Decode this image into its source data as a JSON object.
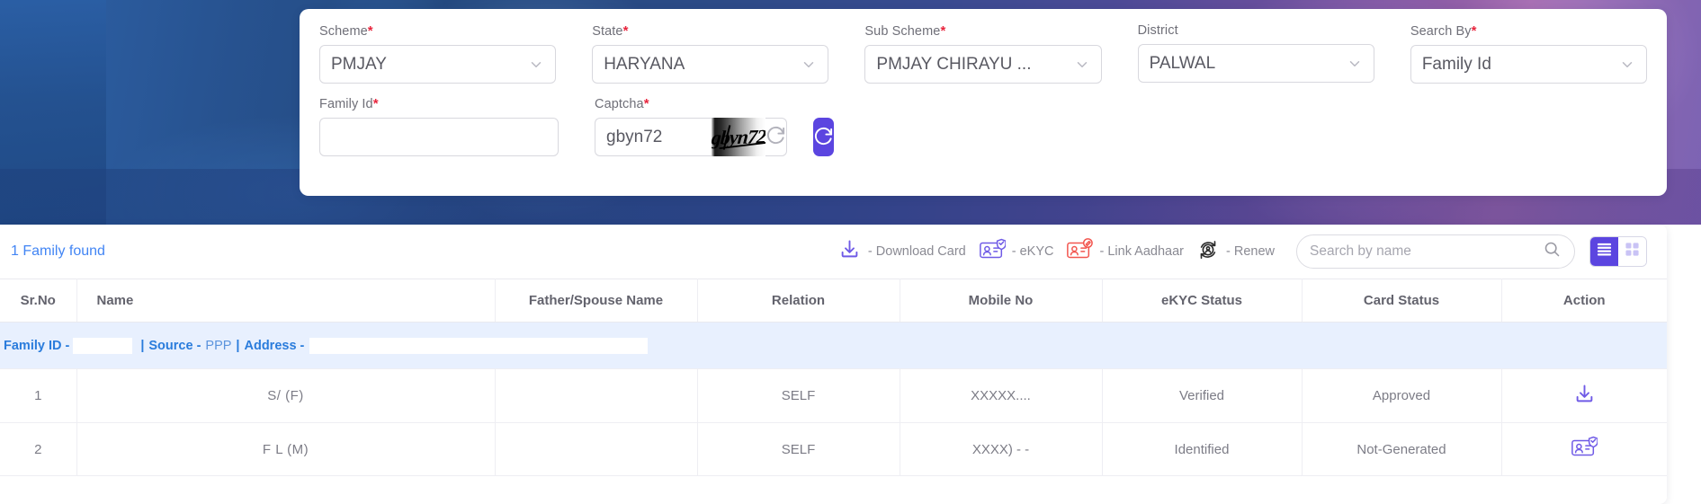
{
  "search_form": {
    "fields": [
      {
        "label": "Scheme",
        "required": true,
        "value": "PMJAY",
        "type": "select",
        "name": "scheme"
      },
      {
        "label": "State",
        "required": true,
        "value": "HARYANA",
        "type": "select",
        "name": "state"
      },
      {
        "label": "Sub Scheme",
        "required": true,
        "value": "PMJAY CHIRAYU ...",
        "type": "select",
        "name": "sub-scheme"
      },
      {
        "label": "District",
        "required": false,
        "value": "PALWAL",
        "type": "select",
        "name": "district"
      },
      {
        "label": "Search By",
        "required": true,
        "value": "Family Id",
        "type": "select",
        "name": "search-by"
      }
    ],
    "family_id": {
      "label": "Family Id",
      "required": true,
      "value": "",
      "placeholder": ""
    },
    "captcha": {
      "label": "Captcha",
      "required": true,
      "value": "gbyn72",
      "image_text": "gbyn72",
      "refresh_icon": "refresh-icon",
      "submit_icon": "refresh-submit-icon"
    }
  },
  "results": {
    "found_text": "1 Family found",
    "legend": [
      {
        "icon": "download-icon",
        "label": "- Download Card",
        "color": "#6f5ae6"
      },
      {
        "icon": "ekyc-card-icon",
        "label": "- eKYC",
        "color": "#6f5ae6"
      },
      {
        "icon": "link-aadhaar-icon",
        "label": "- Link Aadhaar",
        "color": "#f2564f"
      },
      {
        "icon": "renew-icon",
        "label": "- Renew",
        "color": "#2b2b2b"
      }
    ],
    "search": {
      "placeholder": "Search by name",
      "value": "",
      "icon": "search-icon"
    },
    "view_toggle": {
      "list_icon": "list-view-icon",
      "grid_icon": "grid-view-icon",
      "active": "list"
    },
    "table": {
      "columns": [
        "Sr.No",
        "Name",
        "Father/Spouse Name",
        "Relation",
        "Mobile No",
        "eKYC Status",
        "Card Status",
        "Action"
      ],
      "family_banner": {
        "family_id_label": "Family ID -",
        "family_id_value": "",
        "source_label": "Source -",
        "source_value": "PPP",
        "address_label": "Address -",
        "address_value": "",
        "separator": "|"
      },
      "rows": [
        {
          "sr_no": "1",
          "name": "S/             (F)",
          "father_spouse": "",
          "relation": "SELF",
          "mobile": "XXXXX....",
          "ekyc_status": "Verified",
          "ekyc_color": "#52b152",
          "card_status": "Approved",
          "card_color": "#52b152",
          "action_icon": "download-icon"
        },
        {
          "sr_no": "2",
          "name": "F           L (M)",
          "father_spouse": "",
          "relation": "SELF",
          "mobile": "XXXX)      - -",
          "ekyc_status": "Identified",
          "ekyc_color": "#f0a33c",
          "card_status": "Not-Generated",
          "card_color": "#85858f",
          "action_icon": "ekyc-card-icon"
        }
      ]
    }
  },
  "colors": {
    "accent": "#5b45e0",
    "link": "#4285f4",
    "banner_blue": "#e8f0fe",
    "banner_text": "#2a7cdc"
  }
}
